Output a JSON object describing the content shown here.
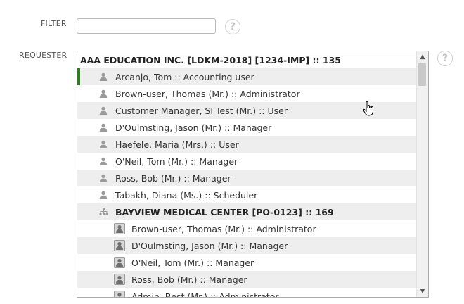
{
  "filter": {
    "label": "FILTER",
    "value": "",
    "help_icon": "question-icon"
  },
  "requester": {
    "label": "REQUESTER",
    "help_icon": "question-icon",
    "rows": [
      {
        "kind": "group-top",
        "text": "AAA EDUCATION INC. [LDKM-2018] [1234-IMP] :: 135",
        "alt": false,
        "selected": false
      },
      {
        "kind": "user",
        "name": "Arcanjo, Tom",
        "role": "Accounting user",
        "alt": true,
        "selected": true
      },
      {
        "kind": "user",
        "name": "Brown-user, Thomas (Mr.)",
        "role": "Administrator",
        "alt": false,
        "selected": false
      },
      {
        "kind": "user",
        "name": "Customer Manager, SI Test (Mr.)",
        "role": "User",
        "alt": true,
        "selected": false
      },
      {
        "kind": "user",
        "name": "D'Oulmsting, Jason (Mr.)",
        "role": "Manager",
        "alt": false,
        "selected": false
      },
      {
        "kind": "user",
        "name": "Haefele, Maria (Mrs.)",
        "role": "User",
        "alt": true,
        "selected": false
      },
      {
        "kind": "user",
        "name": "O'Neil, Tom (Mr.)",
        "role": "Manager",
        "alt": false,
        "selected": false
      },
      {
        "kind": "user",
        "name": "Ross, Bob (Mr.)",
        "role": "Manager",
        "alt": true,
        "selected": false
      },
      {
        "kind": "user",
        "name": "Tabakh, Diana (Ms.)",
        "role": "Scheduler",
        "alt": false,
        "selected": false
      },
      {
        "kind": "group-sub",
        "text": "BAYVIEW MEDICAL CENTER [PO-0123] :: 169",
        "alt": true,
        "selected": false
      },
      {
        "kind": "subuser",
        "name": "Brown-user, Thomas (Mr.)",
        "role": "Administrator",
        "alt": false,
        "selected": false
      },
      {
        "kind": "subuser",
        "name": "D'Oulmsting, Jason (Mr.)",
        "role": "Manager",
        "alt": true,
        "selected": false
      },
      {
        "kind": "subuser",
        "name": "O'Neil, Tom (Mr.)",
        "role": "Manager",
        "alt": false,
        "selected": false
      },
      {
        "kind": "subuser",
        "name": "Ross, Bob (Mr.)",
        "role": "Manager",
        "alt": true,
        "selected": false
      },
      {
        "kind": "subuser",
        "name": "Admin, Best (Mr.)",
        "role": "Administrator",
        "alt": false,
        "selected": false
      }
    ],
    "separator": " :: "
  },
  "colors": {
    "selected_marker": "#2e7d1e",
    "alt_row": "#eeeeee"
  }
}
